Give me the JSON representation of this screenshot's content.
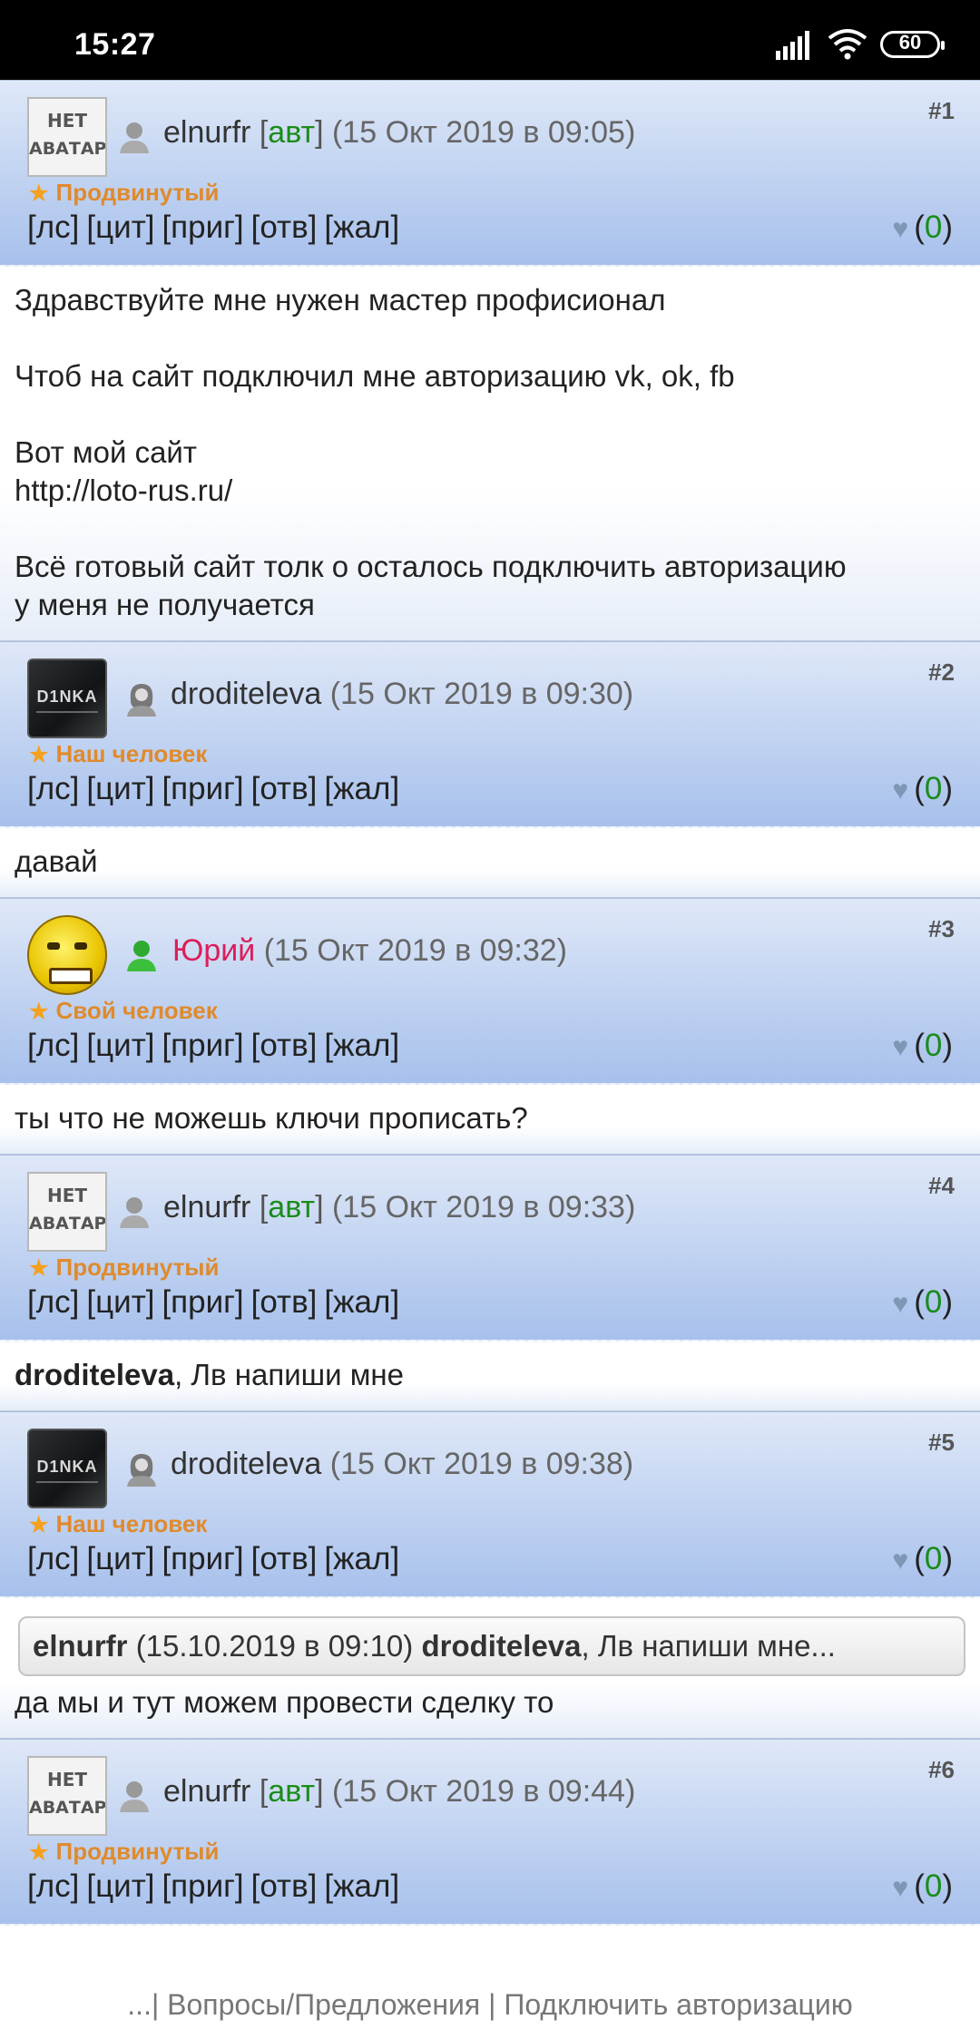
{
  "status_bar": {
    "time": "15:27",
    "battery": "60"
  },
  "posts": [
    {
      "num": "#1",
      "avatar": "none",
      "avatar_line1": "НЕТ",
      "avatar_line2": "АВАТАРА",
      "user_icon": "user-gray-icon",
      "nick": "elnurfr",
      "author_tag": "авт",
      "date": "(15 Окт 2019 в 09:05)",
      "rank": "Продвинутый",
      "actions": [
        "[лс]",
        "[цит]",
        "[приг]",
        "[отв]",
        "[жал]"
      ],
      "likes_open": "(",
      "likes": "0",
      "likes_close": ")",
      "body": [
        "Здравствуйте мне нужен мастер профисионал",
        "",
        "Чтоб на сайт подключил мне авторизацию vk, ok, fb",
        "",
        "Вот мой сайт",
        "http://loto-rus.ru/",
        "",
        "Всё готовый сайт толк о осталось подключить авторизацию",
        "у меня не получается"
      ]
    },
    {
      "num": "#2",
      "avatar": "dark",
      "avatar_text": "D1NKA",
      "user_icon": "user-female-icon",
      "nick": "droditeleva",
      "date": "(15 Окт 2019 в 09:30)",
      "rank": "Наш человек",
      "actions": [
        "[лс]",
        "[цит]",
        "[приг]",
        "[отв]",
        "[жал]"
      ],
      "likes": "0",
      "body": [
        "давай"
      ]
    },
    {
      "num": "#3",
      "avatar": "smile",
      "user_icon": "user-green-icon",
      "nick": "Юрий",
      "date": "(15 Окт 2019 в 09:32)",
      "rank": "Свой человек",
      "actions": [
        "[лс]",
        "[цит]",
        "[приг]",
        "[отв]",
        "[жал]"
      ],
      "likes": "0",
      "body": [
        "ты что не можешь ключи прописать?"
      ]
    },
    {
      "num": "#4",
      "avatar": "none",
      "avatar_line1": "НЕТ",
      "avatar_line2": "АВАТАРА",
      "user_icon": "user-gray-icon",
      "nick": "elnurfr",
      "author_tag": "авт",
      "date": "(15 Окт 2019 в 09:33)",
      "rank": "Продвинутый",
      "actions": [
        "[лс]",
        "[цит]",
        "[приг]",
        "[отв]",
        "[жал]"
      ],
      "likes": "0",
      "body_bold": "droditeleva",
      "body_rest": ", Лв напиши мне"
    },
    {
      "num": "#5",
      "avatar": "dark",
      "avatar_text": "D1NKA",
      "user_icon": "user-female-icon",
      "nick": "droditeleva",
      "date": "(15 Окт 2019 в 09:38)",
      "rank": "Наш человек",
      "actions": [
        "[лс]",
        "[цит]",
        "[приг]",
        "[отв]",
        "[жал]"
      ],
      "likes": "0",
      "quote": {
        "author": "elnurfr",
        "date": "(15.10.2019 в 09:10)",
        "target": "droditeleva",
        "text": ", Лв напиши мне..."
      },
      "body": [
        "да мы и тут можем провести сделку то"
      ]
    },
    {
      "num": "#6",
      "avatar": "none",
      "avatar_line1": "НЕТ",
      "avatar_line2": "АВАТАРА",
      "user_icon": "user-gray-icon",
      "nick": "elnurfr",
      "author_tag": "авт",
      "date": "(15 Окт 2019 в 09:44)",
      "rank": "Продвинутый",
      "actions": [
        "[лс]",
        "[цит]",
        "[приг]",
        "[отв]",
        "[жал]"
      ],
      "likes": "0"
    }
  ],
  "footer": {
    "prefix": "...| ",
    "link1": "Вопросы/Предложения",
    "sep": " | ",
    "link2": "Подключить авторизацию"
  },
  "colors": {
    "author_tag": "#1a8c1a",
    "rank": "#e08a2c",
    "nick_red": "#dc1e5a",
    "header_gradient_end": "#a7c0ec"
  }
}
